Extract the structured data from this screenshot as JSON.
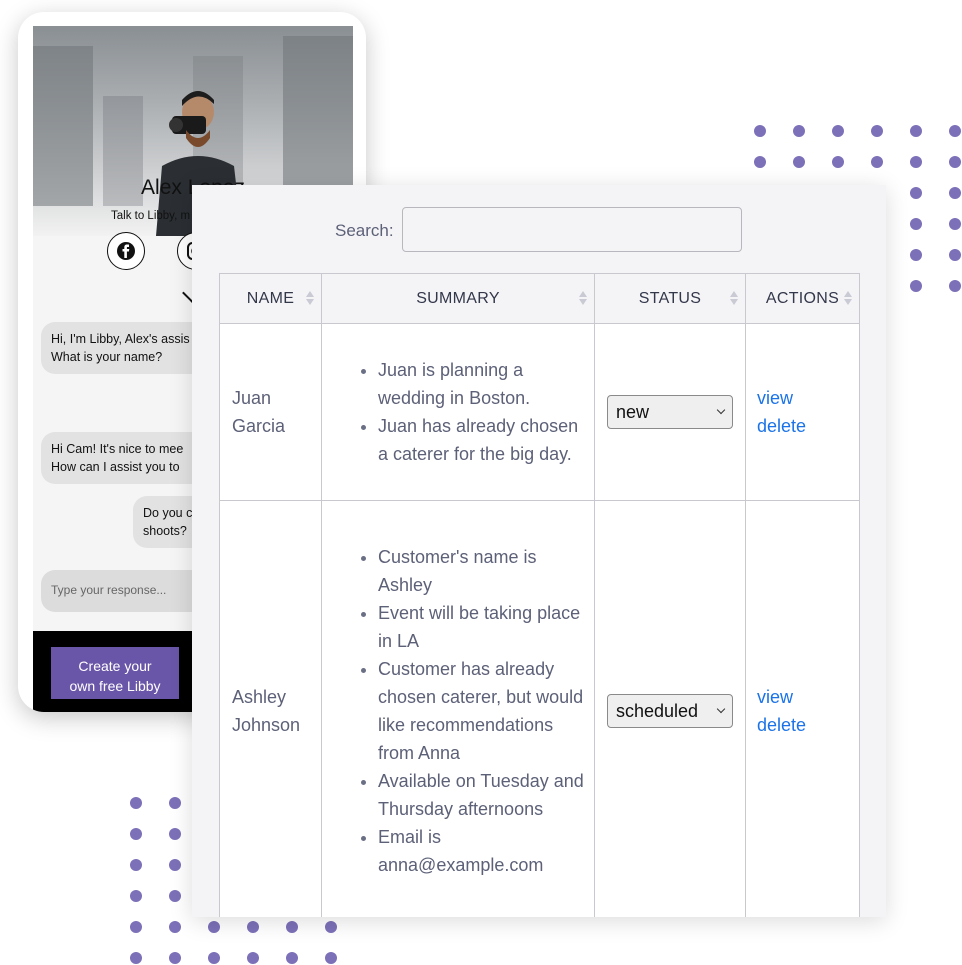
{
  "phone": {
    "profile_name": "Alex Lopez",
    "profile_subtitle": "Talk to Libby, m",
    "social_icons": [
      "facebook-icon",
      "instagram-icon"
    ],
    "messages": [
      {
        "from": "bot",
        "lines": [
          "Hi, I'm Libby, Alex's assis",
          "What is your name?"
        ]
      },
      {
        "from": "bot",
        "lines": [
          "Hi Cam! It's nice to mee",
          "How can I assist you to"
        ]
      },
      {
        "from": "user",
        "lines": [
          "Do you c",
          "shoots?"
        ]
      }
    ],
    "input_placeholder": "Type your response...",
    "cta_line1": "Create your",
    "cta_line2": "own free Libby",
    "cta_color": "#6a56a8"
  },
  "table_view": {
    "search_label": "Search:",
    "search_value": "",
    "columns": [
      "NAME",
      "SUMMARY",
      "STATUS",
      "ACTIONS"
    ],
    "rows": [
      {
        "name_line1": "Juan",
        "name_line2": "Garcia",
        "summary": [
          "Juan is planning a wedding in Boston.",
          "Juan has already chosen a caterer for the big day."
        ],
        "status": "new",
        "action_view": "view",
        "action_delete": "delete"
      },
      {
        "name_line1": "Ashley",
        "name_line2": "Johnson",
        "summary": [
          "Customer's name is Ashley",
          "Event will be taking place in LA",
          "Customer has already chosen caterer, but would like recommendations from Anna",
          "Available on Tuesday and Thursday afternoons",
          "Email is anna@example.com"
        ],
        "status": "scheduled",
        "action_view": "view",
        "action_delete": "delete"
      }
    ],
    "link_color": "#1a73e8"
  },
  "decor": {
    "dot_color": "#7c70b8"
  }
}
